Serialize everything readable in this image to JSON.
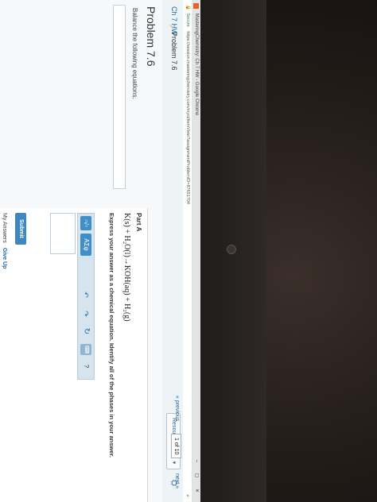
{
  "window": {
    "title": "MasteringChemistry: Ch 7 HW - Google Chrome",
    "controls": "– ▢ ✕"
  },
  "address_bar": {
    "lock_icon": "🔒",
    "secure_label": "Secure",
    "url": "https://session.masteringchemistry.com/myct/itemView?assignmentProblemID=87651704",
    "zoom_icon": "⌕"
  },
  "nav": {
    "breadcrumb_assignment": "Ch 7 HW",
    "breadcrumb_separator": "›",
    "breadcrumb_current": "Problem 7.6",
    "resources_label": "Resources",
    "resources_caret": "▼",
    "resources_icon": "⛭"
  },
  "pager": {
    "previous": "« previous",
    "count": "1 of 10",
    "next": "next »"
  },
  "problem": {
    "title": "Problem 7.6",
    "instructions": "Balance the following equations."
  },
  "part_a": {
    "label": "Part A",
    "equation": "K(s) + H₂O(l)→KOH(aq) + H₂(g)",
    "prompt": "Express your answer as a chemical equation. Identify all of the phases in your answer."
  },
  "toolbar": {
    "template_label": "▫√▫",
    "symbols_label": "ΑΣφ",
    "undo_icon": "↶",
    "redo_icon": "↷",
    "reset_icon": "↻",
    "keyboard_icon": "⌨",
    "help_icon": "?"
  },
  "actions": {
    "submit": "Submit",
    "my_answers": "My Answers",
    "give_up": "Give Up"
  }
}
